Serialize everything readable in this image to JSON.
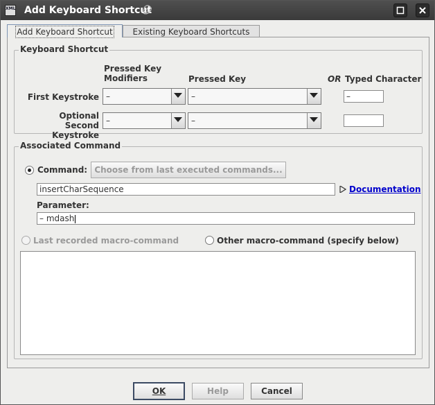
{
  "window": {
    "title": "Add Keyboard Shortcut",
    "app_icon_text": "XML"
  },
  "tabs": [
    {
      "label": "Add Keyboard Shortcut",
      "active": true
    },
    {
      "label": "Existing Keyboard Shortcuts",
      "active": false
    }
  ],
  "keyboard_shortcut": {
    "group_title": "Keyboard Shortcut",
    "col_modifiers": "Pressed Key\nModifiers",
    "col_key": "Pressed Key",
    "col_or": "OR",
    "col_typed": "Typed Character",
    "first_label": "First Keystroke",
    "second_label": "Optional\nSecond Keystroke",
    "first_modifiers": "–",
    "first_key": "–",
    "first_typed": "–",
    "second_modifiers": "–",
    "second_key": "–",
    "second_typed": ""
  },
  "associated_command": {
    "group_title": "Associated Command",
    "command_label": "Command:",
    "choose_button": "Choose from last executed commands...",
    "command_value": "insertCharSequence",
    "documentation_link": "Documentation",
    "parameter_label": "Parameter:",
    "parameter_value": "– mdash",
    "last_macro_label": "Last recorded macro-command",
    "other_macro_label": "Other macro-command (specify below)",
    "macro_text": ""
  },
  "buttons": {
    "ok": "OK",
    "help": "Help",
    "cancel": "Cancel"
  },
  "colors": {
    "titlebar": "#444444",
    "link": "#0000cc",
    "tab_border_active": "#7d93b3"
  }
}
